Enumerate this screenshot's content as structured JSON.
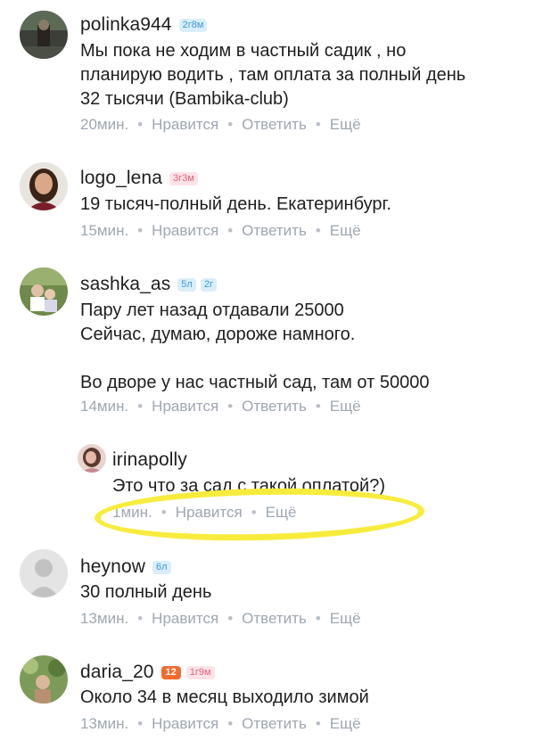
{
  "comments": [
    {
      "username": "polinka944",
      "badges": [
        "2г8м"
      ],
      "lines": [
        "Мы пока не ходим в частный садик , но",
        "планирую водить , там оплата за полный день",
        "32 тысячи (Bambika-club)"
      ],
      "time": "20мин.",
      "like": "Нравится",
      "reply": "Ответить",
      "more": "Ещё"
    },
    {
      "username": "logo_lena",
      "badges": [
        "3г3м"
      ],
      "lines": [
        "19 тысяч-полный день. Екатеринбург."
      ],
      "time": "15мин.",
      "like": "Нравится",
      "reply": "Ответить",
      "more": "Ещё"
    },
    {
      "username": "sashka_as",
      "badges": [
        "5л",
        "2г"
      ],
      "lines": [
        "Пару лет назад отдавали 25000",
        "Сейчас, думаю, дороже намного.",
        "",
        "Во дворе у нас частный сад, там от 50000"
      ],
      "time": "14мин.",
      "like": "Нравится",
      "reply": "Ответить",
      "more": "Ещё"
    },
    {
      "username": "irinapolly",
      "badges": [],
      "lines": [
        "Это что за сад с такой оплатой?)"
      ],
      "time": "1мин.",
      "like": "Нравится",
      "more": "Ещё"
    },
    {
      "username": "heynow",
      "badges": [
        "6л"
      ],
      "lines": [
        "30 полный день"
      ],
      "time": "13мин.",
      "like": "Нравится",
      "reply": "Ответить",
      "more": "Ещё"
    },
    {
      "username": "daria_20",
      "badges": [
        "12",
        "1г9м"
      ],
      "lines": [
        "Около 34 в месяц выходило зимой"
      ],
      "time": "13мин.",
      "like": "Нравится",
      "reply": "Ответить",
      "more": "Ещё"
    }
  ],
  "colors": {
    "text": "#1e1e1e",
    "meta": "#9ea6b0",
    "badge_blue_bg": "#d9eefa",
    "badge_pink_bg": "#fde3e8",
    "badge_orange_bg": "#f26b2e",
    "highlight": "#f7ec3c"
  }
}
